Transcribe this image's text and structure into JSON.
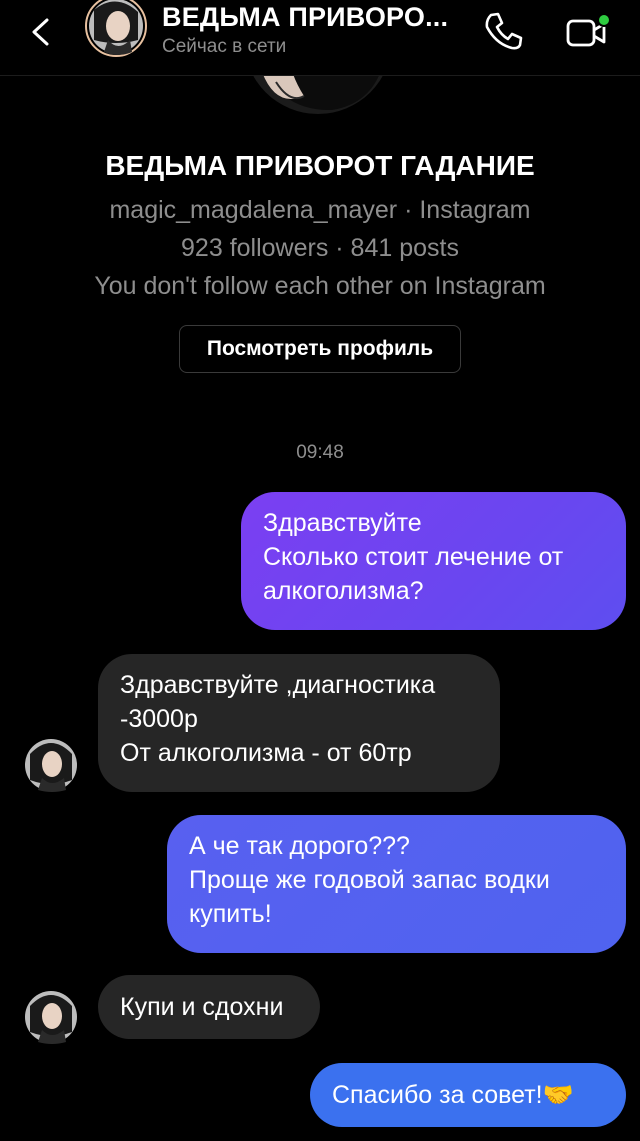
{
  "header": {
    "title": "ВЕДЬМА ПРИВОРО...",
    "status": "Сейчас в сети",
    "icons": [
      "back-chevron-icon",
      "phone-icon",
      "video-camera-icon"
    ]
  },
  "profile": {
    "name": "ВЕДЬМА ПРИВОРОТ ГАДАНИЕ",
    "username_line": "magic_magdalena_mayer · Instagram",
    "stats": "923 followers · 841 posts",
    "follow_status": "You don't follow each other on Instagram",
    "view_profile_label": "Посмотреть профиль"
  },
  "timestamp": "09:48",
  "messages": [
    {
      "from": "me",
      "lines": [
        "Здравствуйте",
        "Сколько стоит лечение от",
        "алкоголизма?"
      ]
    },
    {
      "from": "them",
      "lines": [
        "Здравствуйте ,диагностика",
        "-3000р",
        "От алкоголизма - от 60тр"
      ]
    },
    {
      "from": "me",
      "lines": [
        "А че так дорого???",
        "Проще же годовой запас водки",
        "купить!"
      ]
    },
    {
      "from": "them",
      "lines": [
        "Купи и сдохни"
      ]
    },
    {
      "from": "me",
      "lines": [
        "Спасибо за совет!"
      ],
      "emoji": "🤝"
    }
  ],
  "colors": {
    "background": "#000000",
    "incoming_bubble": "#262626",
    "outgoing_gradient_top": "#7b3ff2",
    "outgoing_gradient_bottom": "#3b71ef",
    "secondary_text": "#8e8e8e",
    "online_dot": "#2ecc40"
  }
}
